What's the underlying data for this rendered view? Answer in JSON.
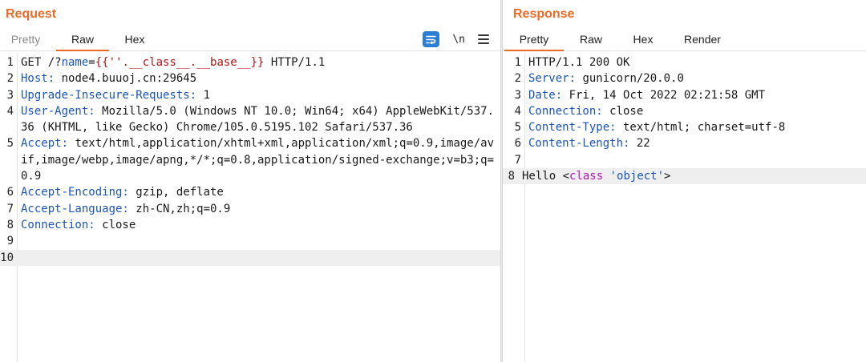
{
  "request": {
    "title": "Request",
    "tabs": [
      "Pretty",
      "Raw",
      "Hex"
    ],
    "active_tab": "Raw",
    "toolbar": {
      "newline_label": "\\n"
    },
    "lines": [
      {
        "n": "1",
        "parts": [
          {
            "t": "GET /?",
            "c": "c"
          },
          {
            "t": "name",
            "c": "k"
          },
          {
            "t": "=",
            "c": "c"
          },
          {
            "t": "{{''.__class__.__base__}}",
            "c": "p"
          },
          {
            "t": " HTTP/1.1",
            "c": "c"
          }
        ]
      },
      {
        "n": "2",
        "parts": [
          {
            "t": "Host:",
            "c": "k"
          },
          {
            "t": " node4.buuoj.cn:29645",
            "c": "c"
          }
        ]
      },
      {
        "n": "3",
        "parts": [
          {
            "t": "Upgrade-Insecure-Requests:",
            "c": "k"
          },
          {
            "t": " 1",
            "c": "c"
          }
        ]
      },
      {
        "n": "4",
        "parts": [
          {
            "t": "User-Agent:",
            "c": "k"
          },
          {
            "t": " Mozilla/5.0 (Windows NT 10.0; Win64; x64) AppleWebKit/537.36 (KHTML, like Gecko) Chrome/105.0.5195.102 Safari/537.36",
            "c": "c"
          }
        ]
      },
      {
        "n": "5",
        "parts": [
          {
            "t": "Accept:",
            "c": "k"
          },
          {
            "t": " text/html,application/xhtml+xml,application/xml;q=0.9,image/avif,image/webp,image/apng,*/*;q=0.8,application/signed-exchange;v=b3;q=0.9",
            "c": "c"
          }
        ]
      },
      {
        "n": "6",
        "parts": [
          {
            "t": "Accept-Encoding:",
            "c": "k"
          },
          {
            "t": " gzip, deflate",
            "c": "c"
          }
        ]
      },
      {
        "n": "7",
        "parts": [
          {
            "t": "Accept-Language:",
            "c": "k"
          },
          {
            "t": " zh-CN,zh;q=0.9",
            "c": "c"
          }
        ]
      },
      {
        "n": "8",
        "parts": [
          {
            "t": "Connection:",
            "c": "k"
          },
          {
            "t": " close",
            "c": "c"
          }
        ]
      },
      {
        "n": "9",
        "parts": []
      },
      {
        "n": "10",
        "parts": [],
        "current": true
      }
    ]
  },
  "response": {
    "title": "Response",
    "tabs": [
      "Pretty",
      "Raw",
      "Hex",
      "Render"
    ],
    "active_tab": "Pretty",
    "lines": [
      {
        "n": "1",
        "parts": [
          {
            "t": "HTTP/1.1 200 OK",
            "c": "c"
          }
        ]
      },
      {
        "n": "2",
        "parts": [
          {
            "t": "Server:",
            "c": "k"
          },
          {
            "t": " gunicorn/20.0.0",
            "c": "c"
          }
        ]
      },
      {
        "n": "3",
        "parts": [
          {
            "t": "Date:",
            "c": "k"
          },
          {
            "t": " Fri, 14 Oct 2022 02:21:58 GMT",
            "c": "c"
          }
        ]
      },
      {
        "n": "4",
        "parts": [
          {
            "t": "Connection:",
            "c": "k"
          },
          {
            "t": " close",
            "c": "c"
          }
        ]
      },
      {
        "n": "5",
        "parts": [
          {
            "t": "Content-Type:",
            "c": "k"
          },
          {
            "t": " text/html; charset=utf-8",
            "c": "c"
          }
        ]
      },
      {
        "n": "6",
        "parts": [
          {
            "t": "Content-Length:",
            "c": "k"
          },
          {
            "t": " 22",
            "c": "c"
          }
        ]
      },
      {
        "n": "7",
        "parts": []
      },
      {
        "n": "8",
        "parts": [
          {
            "t": "Hello <",
            "c": "c"
          },
          {
            "t": "class",
            "c": "tag"
          },
          {
            "t": " ",
            "c": "c"
          },
          {
            "t": "'object'",
            "c": "str"
          },
          {
            "t": ">",
            "c": "c"
          }
        ],
        "current": true
      }
    ]
  },
  "colors": {
    "accent": "#ec6a26",
    "header_key": "#1b55b8",
    "payload": "#b01818",
    "tag": "#b515b5",
    "wrap_button": "#2a7fd4"
  },
  "icons": {
    "wrap": "text-wrap-icon",
    "menu": "hamburger-menu-icon"
  }
}
